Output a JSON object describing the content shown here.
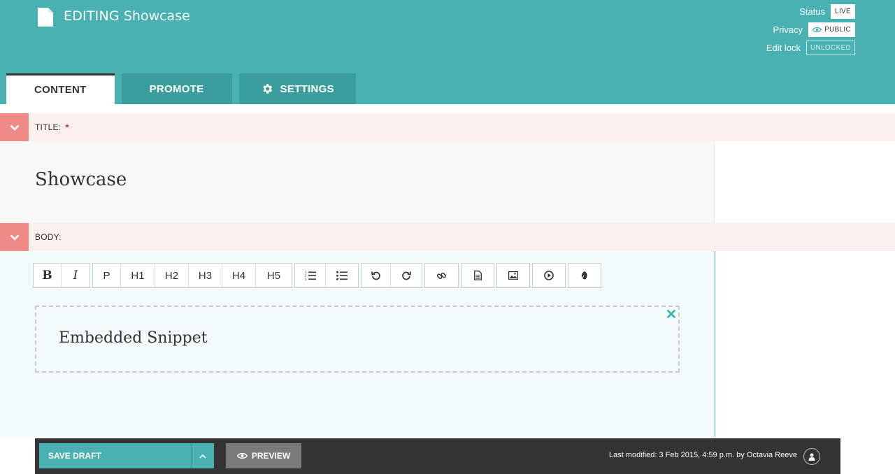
{
  "header": {
    "editing_label": "EDITING",
    "page_name": "Showcase",
    "status_label": "Status",
    "status_value": "LIVE",
    "privacy_label": "Privacy",
    "privacy_value": "PUBLIC",
    "lock_label": "Edit lock",
    "lock_value": "UNLOCKED"
  },
  "tabs": [
    {
      "label": "CONTENT",
      "active": true
    },
    {
      "label": "PROMOTE",
      "active": false
    },
    {
      "label": "SETTINGS",
      "active": false,
      "icon": "gear-icon"
    }
  ],
  "fields": {
    "title_label": "TITLE:",
    "required_mark": "*",
    "title_value": "Showcase",
    "body_label": "BODY:"
  },
  "toolbar": {
    "bold": "B",
    "italic": "I",
    "p": "P",
    "h1": "H1",
    "h2": "H2",
    "h3": "H3",
    "h4": "H4",
    "h5": "H5",
    "icons": [
      "ordered-list-icon",
      "unordered-list-icon",
      "undo-icon",
      "redo-icon",
      "link-icon",
      "document-icon",
      "image-icon",
      "media-icon",
      "snippet-icon"
    ]
  },
  "snippet": {
    "text": "Embedded Snippet"
  },
  "footer": {
    "save_label": "SAVE DRAFT",
    "preview_label": "PREVIEW",
    "last_modified": "Last modified: 3 Feb 2015, 4:59 p.m. by Octavia Reeve"
  },
  "colors": {
    "header_teal": "#49b1b1",
    "tab_dark_teal": "#3a9e9e",
    "field_header_pink": "#fcf0ef",
    "collapse_salmon": "#ef8a86",
    "footer_dark": "#333333",
    "preview_grey": "#7a7a7a"
  }
}
